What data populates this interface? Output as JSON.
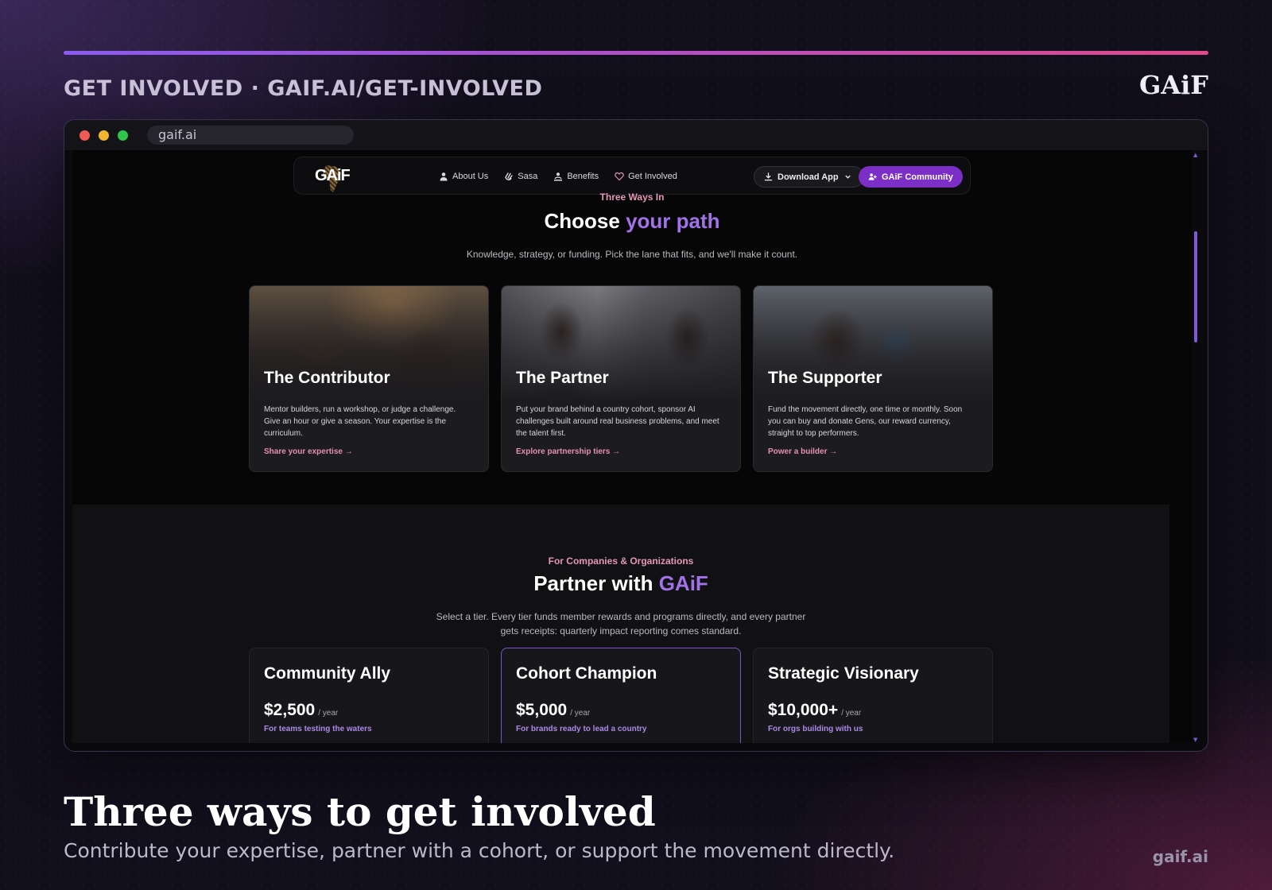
{
  "header": {
    "eyebrow": "GET INVOLVED · GAIF.AI/GET-INVOLVED",
    "logo": "GAiF"
  },
  "browser": {
    "url": "gaif.ai"
  },
  "site_nav": {
    "logo_text": "GAiF",
    "links": [
      {
        "label": "About Us",
        "icon": "person-icon"
      },
      {
        "label": "Sasa",
        "icon": "hand-icon"
      },
      {
        "label": "Benefits",
        "icon": "gift-icon"
      },
      {
        "label": "Get Involved",
        "icon": "heart-icon"
      }
    ],
    "download_label": "Download App",
    "community_label": "GAiF Community"
  },
  "paths": {
    "kicker": "Three Ways In",
    "title_plain": "Choose",
    "title_accent": "your path",
    "subtitle": "Knowledge, strategy, or funding. Pick the lane that fits, and we'll make it count.",
    "cards": [
      {
        "title": "The Contributor",
        "description": "Mentor builders, run a workshop, or judge a challenge. Give an hour or give a season. Your expertise is the curriculum.",
        "link": "Share your expertise →"
      },
      {
        "title": "The Partner",
        "description": "Put your brand behind a country cohort, sponsor AI challenges built around real business problems, and meet the talent first.",
        "link": "Explore partnership tiers →"
      },
      {
        "title": "The Supporter",
        "description": "Fund the movement directly, one time or monthly. Soon you can buy and donate Gens, our reward currency, straight to top performers.",
        "link": "Power a builder →"
      }
    ]
  },
  "partner": {
    "kicker": "For Companies & Organizations",
    "title_plain": "Partner with",
    "title_accent": "GAiF",
    "subtitle_line1": "Select a tier. Every tier funds member rewards and programs directly, and every partner",
    "subtitle_line2": "gets receipts: quarterly impact reporting comes standard.",
    "tiers": [
      {
        "name": "Community Ally",
        "price": "$2,500",
        "period": "/ year",
        "note": "For teams testing the waters"
      },
      {
        "name": "Cohort Champion",
        "price": "$5,000",
        "period": "/ year",
        "note": "For brands ready to lead a country"
      },
      {
        "name": "Strategic Visionary",
        "price": "$10,000+",
        "period": "/ year",
        "note": "For orgs building with us"
      }
    ]
  },
  "caption": {
    "title": "Three ways to get involved",
    "subtitle": "Contribute your expertise, partner with a cohort, or support the movement directly.",
    "site": "gaif.ai"
  },
  "colors": {
    "accent_purple": "#7b2fc6",
    "accent_pink": "#e58fb4",
    "gradient_start": "#8a5cf0",
    "gradient_end": "#e04a8a"
  }
}
